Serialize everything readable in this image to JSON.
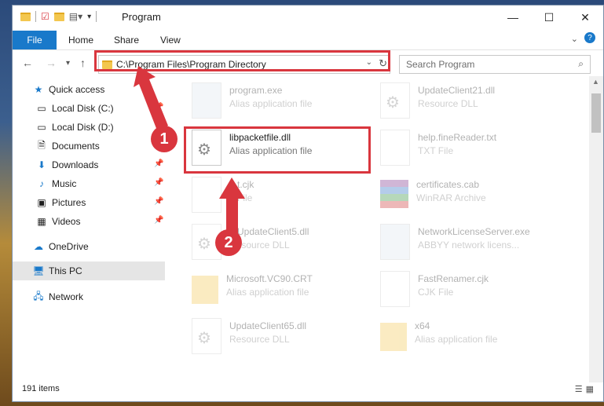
{
  "window": {
    "title": "Program"
  },
  "ribbon": {
    "file_label": "File",
    "tabs": [
      "Home",
      "Share",
      "View"
    ]
  },
  "address": {
    "path": "C:\\Program Files\\Program Directory"
  },
  "search": {
    "placeholder": "Search Program"
  },
  "sidebar": {
    "items": [
      {
        "label": "Quick access",
        "icon": "star-icon"
      },
      {
        "label": "Local Disk (C:)",
        "icon": "drive-icon"
      },
      {
        "label": "Local Disk (D:)",
        "icon": "drive-icon"
      },
      {
        "label": "Documents",
        "icon": "documents-icon"
      },
      {
        "label": "Downloads",
        "icon": "download-icon"
      },
      {
        "label": "Music",
        "icon": "music-icon"
      },
      {
        "label": "Pictures",
        "icon": "pictures-icon"
      },
      {
        "label": "Videos",
        "icon": "videos-icon"
      },
      {
        "label": "OneDrive",
        "icon": "cloud-icon"
      },
      {
        "label": "This PC",
        "icon": "pc-icon"
      },
      {
        "label": "Network",
        "icon": "network-icon"
      }
    ]
  },
  "files": [
    {
      "name": "program.exe",
      "desc": "Alias application file"
    },
    {
      "name": "UpdateClient21.dll",
      "desc": "Resource DLL"
    },
    {
      "name": "libpacketfile.dll",
      "desc": "Alias application file"
    },
    {
      "name": "help.fineReader.txt",
      "desc": "TXT File"
    },
    {
      "name": "...t.cjk",
      "desc": "...File"
    },
    {
      "name": "certificates.cab",
      "desc": "WinRAR Archive"
    },
    {
      "name": "...UpdateClient5.dll",
      "desc": "Resource DLL"
    },
    {
      "name": "NetworkLicenseServer.exe",
      "desc": "ABBYY network licens..."
    },
    {
      "name": "Microsoft.VC90.CRT",
      "desc": "Alias application file"
    },
    {
      "name": "FastRenamer.cjk",
      "desc": "CJK File"
    },
    {
      "name": "UpdateClient65.dll",
      "desc": "Resource DLL"
    },
    {
      "name": "x64",
      "desc": "Alias application file"
    }
  ],
  "status": {
    "items_count": "191 items"
  },
  "annotations": {
    "step1": "1",
    "step2": "2"
  },
  "colors": {
    "accent": "#1979ca",
    "highlight": "#d9363e"
  }
}
